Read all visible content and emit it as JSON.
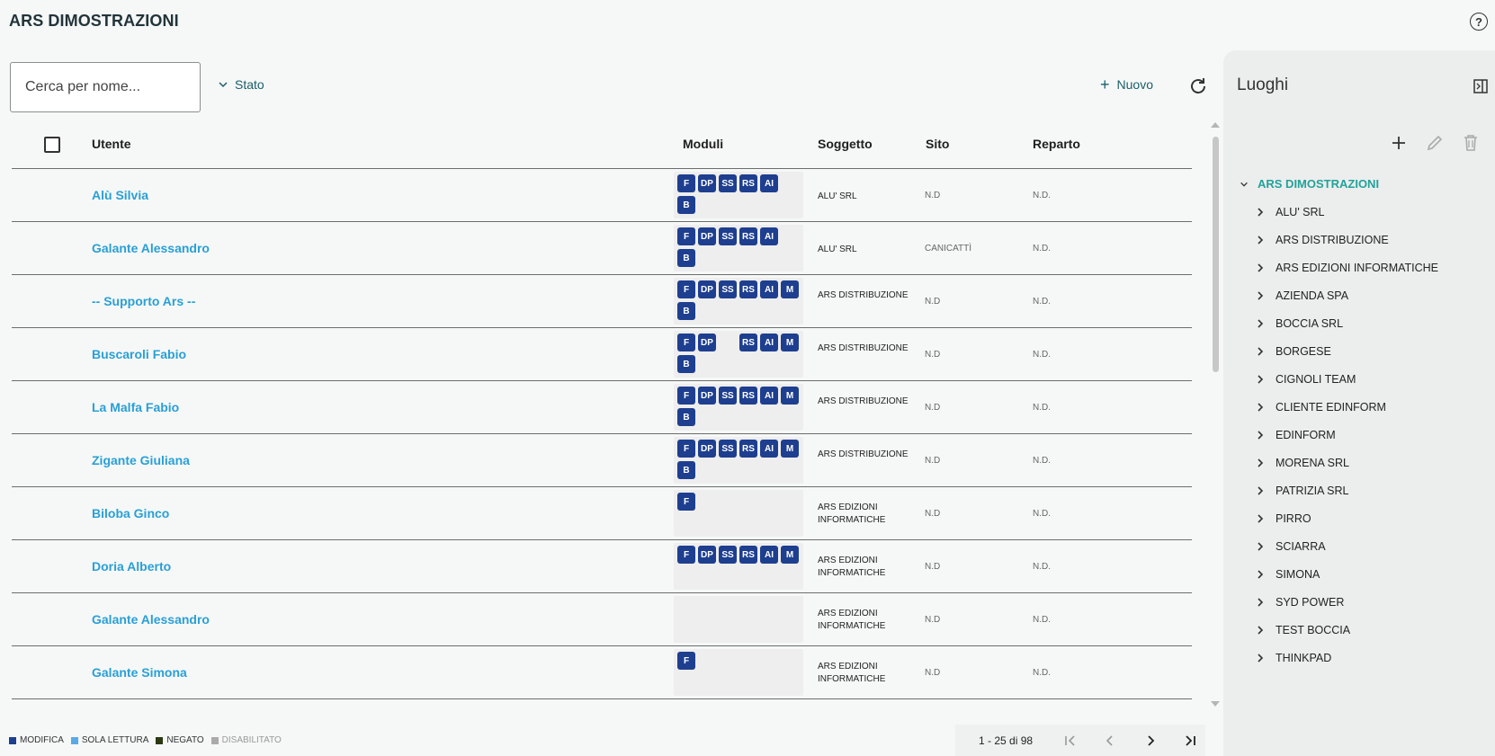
{
  "header": {
    "title": "ARS DIMOSTRAZIONI",
    "help_icon": "help-circle-icon"
  },
  "toolbar": {
    "search_placeholder": "Cerca per nome...",
    "search_value": "",
    "stato_label": "Stato",
    "nuovo_label": "Nuovo"
  },
  "table": {
    "columns": [
      "Utente",
      "Moduli",
      "Soggetto",
      "Sito",
      "Reparto"
    ],
    "rows": [
      {
        "name": "Alù Silvia",
        "modules": [
          "F",
          "DP",
          "SS",
          "RS",
          "AI",
          "",
          "B"
        ],
        "soggetto": "ALU' SRL",
        "sito": "N.D",
        "reparto": "N.D."
      },
      {
        "name": "Galante Alessandro",
        "modules": [
          "F",
          "DP",
          "SS",
          "RS",
          "AI",
          "",
          "B"
        ],
        "soggetto": "ALU' SRL",
        "sito": "CANICATTÌ",
        "reparto": "N.D."
      },
      {
        "name": "-- Supporto Ars --",
        "modules": [
          "F",
          "DP",
          "SS",
          "RS",
          "AI",
          "M",
          "B"
        ],
        "soggetto": "ARS DISTRIBUZIONE",
        "sito": "N.D",
        "reparto": "N.D."
      },
      {
        "name": "Buscaroli Fabio",
        "modules": [
          "F",
          "DP",
          "",
          "RS",
          "AI",
          "M",
          "B"
        ],
        "soggetto": "ARS DISTRIBUZIONE",
        "sito": "N.D",
        "reparto": "N.D."
      },
      {
        "name": "La Malfa Fabio",
        "modules": [
          "F",
          "DP",
          "SS",
          "RS",
          "AI",
          "M",
          "B"
        ],
        "soggetto": "ARS DISTRIBUZIONE",
        "sito": "N.D",
        "reparto": "N.D."
      },
      {
        "name": "Zigante Giuliana",
        "modules": [
          "F",
          "DP",
          "SS",
          "RS",
          "AI",
          "M",
          "B"
        ],
        "soggetto": "ARS DISTRIBUZIONE",
        "sito": "N.D",
        "reparto": "N.D."
      },
      {
        "name": "Biloba Ginco",
        "modules": [
          "F"
        ],
        "soggetto": "ARS EDIZIONI INFORMATICHE",
        "sito": "N.D",
        "reparto": "N.D."
      },
      {
        "name": "Doria Alberto",
        "modules": [
          "F",
          "DP",
          "SS",
          "RS",
          "AI",
          "M"
        ],
        "soggetto": "ARS EDIZIONI INFORMATICHE",
        "sito": "N.D",
        "reparto": "N.D."
      },
      {
        "name": "Galante Alessandro",
        "modules": [],
        "soggetto": "ARS EDIZIONI INFORMATICHE",
        "sito": "N.D",
        "reparto": "N.D."
      },
      {
        "name": "Galante Simona",
        "modules": [
          "F"
        ],
        "soggetto": "ARS EDIZIONI INFORMATICHE",
        "sito": "N.D",
        "reparto": "N.D."
      }
    ]
  },
  "legend": [
    {
      "label": "MODIFICA",
      "color": "#1e3f8f"
    },
    {
      "label": "SOLA LETTURA",
      "color": "#5aa9e6"
    },
    {
      "label": "NEGATO",
      "color": "#2b3a12"
    },
    {
      "label": "DISABILITATO",
      "color": "#aaaaaa"
    }
  ],
  "pager": {
    "range": "1 - 25 di 98"
  },
  "side_panel": {
    "title": "Luoghi",
    "root": "ARS DIMOSTRAZIONI",
    "items": [
      "ALU' SRL",
      "ARS DISTRIBUZIONE",
      "ARS EDIZIONI INFORMATICHE",
      "AZIENDA SPA",
      "BOCCIA SRL",
      "BORGESE",
      "CIGNOLI TEAM",
      "CLIENTE EDINFORM",
      "EDINFORM",
      "MORENA SRL",
      "PATRIZIA SRL",
      "PIRRO",
      "SCIARRA",
      "SIMONA",
      "SYD POWER",
      "TEST BOCCIA",
      "THINKPAD"
    ]
  },
  "colors": {
    "accent": "#1b5e6a",
    "link": "#2a9fd6",
    "badge": "#1e3f8f",
    "tree_root": "#24a19a"
  }
}
